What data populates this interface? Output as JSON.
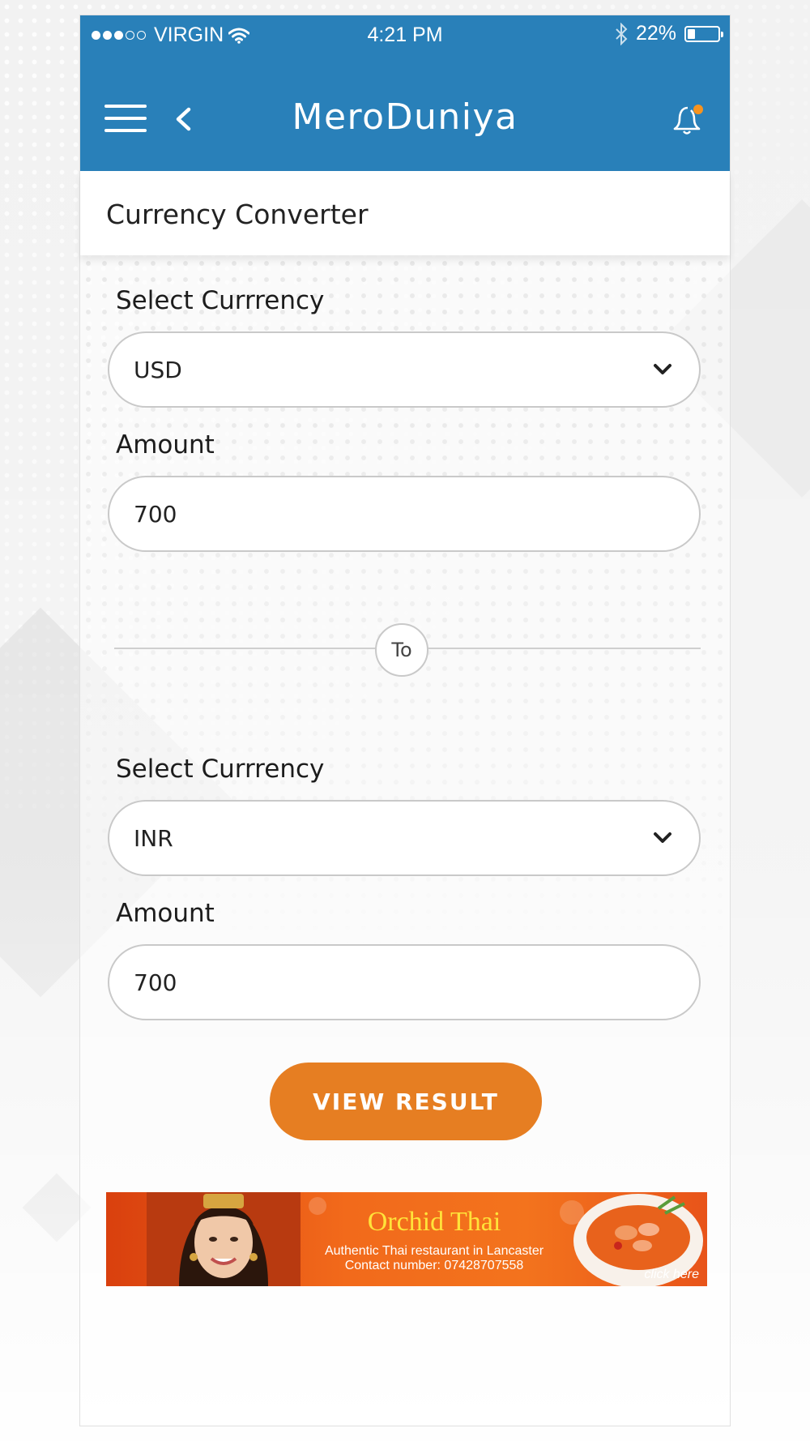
{
  "status_bar": {
    "carrier": "VIRGIN",
    "time": "4:21 PM",
    "battery": "22%",
    "battery_level": 0.22
  },
  "app_bar": {
    "title": "MeroDuniya",
    "menu_icon": "hamburger-menu-icon",
    "back_icon": "chevron-left-icon",
    "notification_icon": "bell-icon",
    "notification_dot_color": "#f7931e"
  },
  "page": {
    "title": "Currency Converter"
  },
  "from": {
    "currency_label": "Select Currrency",
    "currency_value": "USD",
    "amount_label": "Amount",
    "amount_value": "700"
  },
  "separator": {
    "label": "To"
  },
  "to": {
    "currency_label": "Select Currrency",
    "currency_value": "INR",
    "amount_label": "Amount",
    "amount_value": "700"
  },
  "actions": {
    "view_result": "VIEW RESULT"
  },
  "ad": {
    "brand": "Orchid Thai",
    "line1": "Authentic Thai restaurant in Lancaster",
    "line2": "Contact number: 07428707558",
    "cta": "click here"
  },
  "colors": {
    "primary": "#2980b9",
    "accent": "#e67e22",
    "ad_orange": "#f26a1b"
  }
}
